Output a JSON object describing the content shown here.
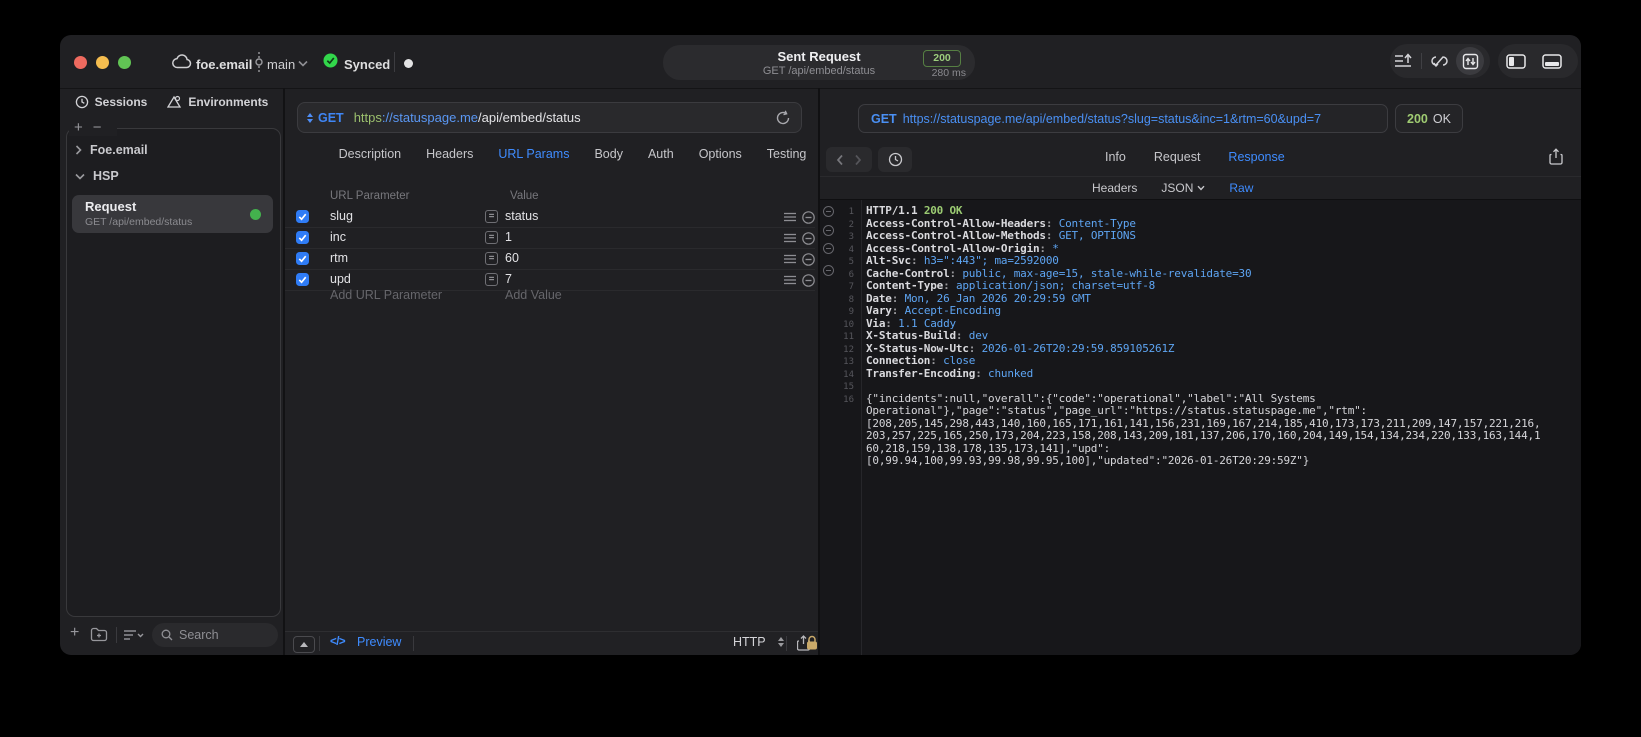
{
  "titlebar": {
    "project": "foe.email",
    "branch": "main",
    "sync_status": "Synced",
    "request_title": "Sent Request",
    "request_subtitle": "GET /api/embed/status",
    "status_code": "200",
    "duration": "280 ms"
  },
  "sidebar": {
    "tabs": [
      {
        "label": "Sessions",
        "icon": "clock-icon"
      },
      {
        "label": "Environments",
        "icon": "environments-icon"
      }
    ],
    "groups": [
      {
        "label": "Foe.email",
        "expanded": false
      },
      {
        "label": "HSP",
        "expanded": true
      }
    ],
    "request_item": {
      "title": "Request",
      "subtitle": "GET /api/embed/status",
      "status_color": "#43b14d"
    },
    "search_placeholder": "Search"
  },
  "request_pane": {
    "method": "GET",
    "url_scheme": "https",
    "url_host": "://statuspage.me",
    "url_path": "/api/embed/status",
    "tabs": [
      "Description",
      "Headers",
      "URL Params",
      "Body",
      "Auth",
      "Options",
      "Testing"
    ],
    "active_tab": "URL Params",
    "params_table": {
      "columns": [
        "URL Parameter",
        "Value"
      ],
      "match_symbol": "=",
      "rows": [
        {
          "checked": true,
          "name": "slug",
          "value": "status"
        },
        {
          "checked": true,
          "name": "inc",
          "value": "1"
        },
        {
          "checked": true,
          "name": "rtm",
          "value": "60"
        },
        {
          "checked": true,
          "name": "upd",
          "value": "7"
        }
      ],
      "add_name_placeholder": "Add URL Parameter",
      "add_value_placeholder": "Add Value"
    },
    "footer": {
      "code_glyph": "</>",
      "preview_label": "Preview",
      "protocol": "HTTP"
    }
  },
  "response_pane": {
    "request_line": "https://statuspage.me/api/embed/status?slug=status&inc=1&rtm=60&upd=7",
    "request_method": "GET",
    "status_code": "200",
    "status_text": "OK",
    "tabs": [
      "Info",
      "Request",
      "Response"
    ],
    "active_tab": "Response",
    "subtabs": [
      {
        "label": "Headers"
      },
      {
        "label": "JSON",
        "chevron": true
      },
      {
        "label": "Raw"
      }
    ],
    "active_subtab": "Raw",
    "lines": [
      {
        "n": "1",
        "parts": [
          {
            "t": "HTTP/1.1 ",
            "c": "name"
          },
          {
            "t": "200 OK",
            "c": "green"
          }
        ]
      },
      {
        "n": "2",
        "parts": [
          {
            "t": "Access-Control-Allow-Headers",
            "c": "name"
          },
          {
            "t": ": ",
            "c": "sep"
          },
          {
            "t": "Content-Type",
            "c": "val"
          }
        ]
      },
      {
        "n": "3",
        "parts": [
          {
            "t": "Access-Control-Allow-Methods",
            "c": "name"
          },
          {
            "t": ": ",
            "c": "sep"
          },
          {
            "t": "GET, OPTIONS",
            "c": "val"
          }
        ]
      },
      {
        "n": "4",
        "parts": [
          {
            "t": "Access-Control-Allow-Origin",
            "c": "name"
          },
          {
            "t": ": ",
            "c": "sep"
          },
          {
            "t": "*",
            "c": "val"
          }
        ]
      },
      {
        "n": "5",
        "parts": [
          {
            "t": "Alt-Svc",
            "c": "name"
          },
          {
            "t": ": ",
            "c": "sep"
          },
          {
            "t": "h3=\":443\"; ma=2592000",
            "c": "val"
          }
        ]
      },
      {
        "n": "6",
        "parts": [
          {
            "t": "Cache-Control",
            "c": "name"
          },
          {
            "t": ": ",
            "c": "sep"
          },
          {
            "t": "public, max-age=15, stale-while-revalidate=30",
            "c": "val"
          }
        ]
      },
      {
        "n": "7",
        "parts": [
          {
            "t": "Content-Type",
            "c": "name"
          },
          {
            "t": ": ",
            "c": "sep"
          },
          {
            "t": "application/json; charset=utf-8",
            "c": "val"
          }
        ]
      },
      {
        "n": "8",
        "parts": [
          {
            "t": "Date",
            "c": "name"
          },
          {
            "t": ": ",
            "c": "sep"
          },
          {
            "t": "Mon, 26 Jan 2026 20:29:59 GMT",
            "c": "val"
          }
        ]
      },
      {
        "n": "9",
        "parts": [
          {
            "t": "Vary",
            "c": "name"
          },
          {
            "t": ": ",
            "c": "sep"
          },
          {
            "t": "Accept-Encoding",
            "c": "val"
          }
        ]
      },
      {
        "n": "10",
        "parts": [
          {
            "t": "Via",
            "c": "name"
          },
          {
            "t": ": ",
            "c": "sep"
          },
          {
            "t": "1.1 Caddy",
            "c": "val"
          }
        ]
      },
      {
        "n": "11",
        "parts": [
          {
            "t": "X-Status-Build",
            "c": "name"
          },
          {
            "t": ": ",
            "c": "sep"
          },
          {
            "t": "dev",
            "c": "val"
          }
        ]
      },
      {
        "n": "12",
        "parts": [
          {
            "t": "X-Status-Now-Utc",
            "c": "name"
          },
          {
            "t": ": ",
            "c": "sep"
          },
          {
            "t": "2026-01-26T20:29:59.859105261Z",
            "c": "val"
          }
        ]
      },
      {
        "n": "13",
        "parts": [
          {
            "t": "Connection",
            "c": "name"
          },
          {
            "t": ": ",
            "c": "sep"
          },
          {
            "t": "close",
            "c": "val"
          }
        ]
      },
      {
        "n": "14",
        "parts": [
          {
            "t": "Transfer-Encoding",
            "c": "name"
          },
          {
            "t": ": ",
            "c": "sep"
          },
          {
            "t": "chunked",
            "c": "val"
          }
        ]
      },
      {
        "n": "15",
        "parts": []
      },
      {
        "n": "16",
        "parts": [
          {
            "t": "{\"incidents\":null,\"overall\":{\"code\":\"operational\",\"label\":\"All Systems",
            "c": "body"
          }
        ]
      },
      {
        "n": "",
        "parts": [
          {
            "t": "Operational\"},\"page\":\"status\",\"page_url\":\"https://status.statuspage.me\",\"rtm\":",
            "c": "body"
          }
        ]
      },
      {
        "n": "",
        "parts": [
          {
            "t": "[208,205,145,298,443,140,160,165,171,161,141,156,231,169,167,214,185,410,173,173,211,209,147,157,221,216,",
            "c": "body"
          }
        ]
      },
      {
        "n": "",
        "parts": [
          {
            "t": "203,257,225,165,250,173,204,223,158,208,143,209,181,137,206,170,160,204,149,154,134,234,220,133,163,144,1",
            "c": "body"
          }
        ]
      },
      {
        "n": "",
        "parts": [
          {
            "t": "60,218,159,138,178,135,173,141],\"upd\":",
            "c": "body"
          }
        ]
      },
      {
        "n": "",
        "parts": [
          {
            "t": "[0,99.94,100,99.93,99.98,99.95,100],\"updated\":\"2026-01-26T20:29:59Z\"}",
            "c": "body"
          }
        ]
      }
    ]
  },
  "colors": {
    "accent_blue": "#3f8cff",
    "status_green": "#9bcb72",
    "checkbox_blue": "#2f7cf6",
    "sync_green": "#32d74b"
  }
}
